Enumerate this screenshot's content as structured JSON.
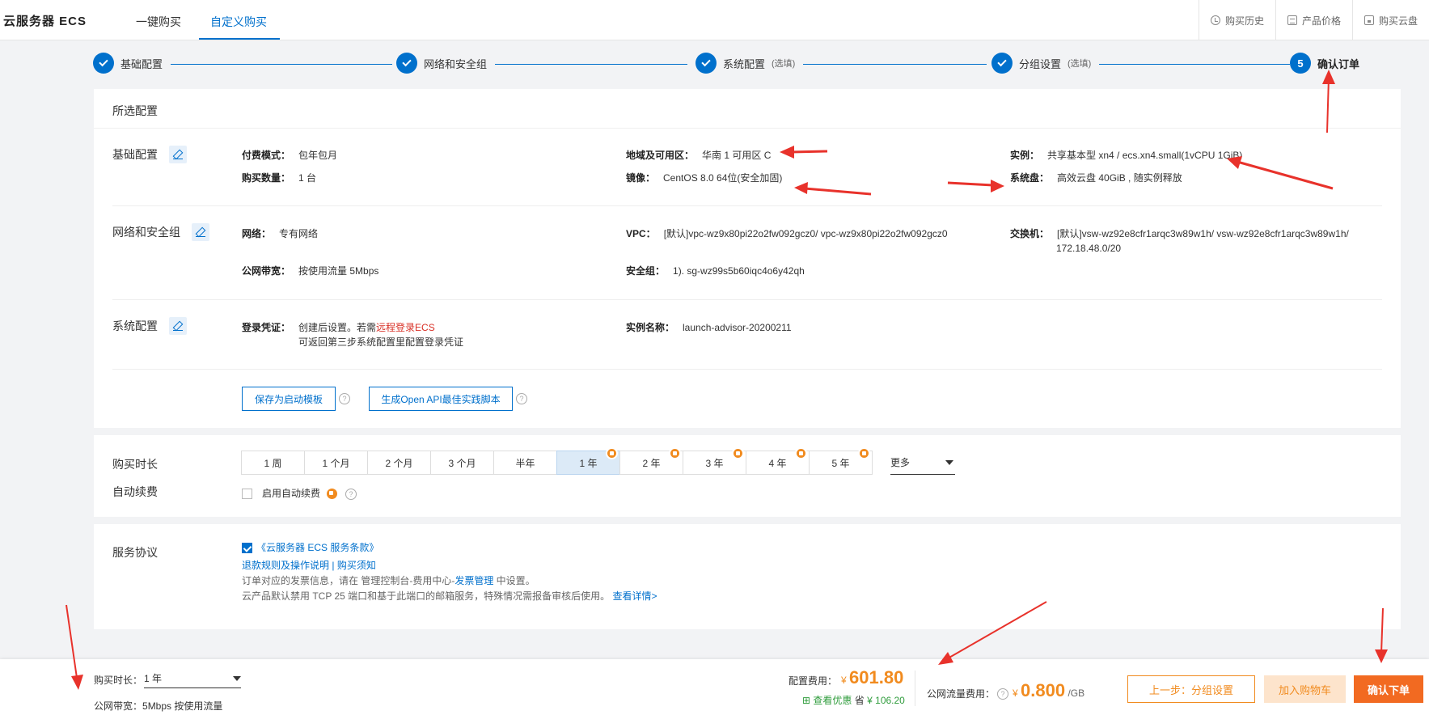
{
  "header": {
    "brand": "云服务器 ECS",
    "tabs": [
      "一键购买",
      "自定义购买"
    ],
    "links": [
      "购买历史",
      "产品价格",
      "购买云盘"
    ]
  },
  "steps": [
    {
      "label": "基础配置",
      "optional": ""
    },
    {
      "label": "网络和安全组",
      "optional": ""
    },
    {
      "label": "系统配置",
      "optional": "(选填)"
    },
    {
      "label": "分组设置",
      "optional": "(选填)"
    },
    {
      "num": "5",
      "label": "确认订单"
    }
  ],
  "summary": {
    "title": "所选配置",
    "basic": {
      "label": "基础配置",
      "pay_mode_k": "付费模式：",
      "pay_mode_v": "包年包月",
      "qty_k": "购买数量：",
      "qty_v": "1 台",
      "region_k": "地域及可用区：",
      "region_v": "华南 1 可用区 C",
      "image_k": "镜像：",
      "image_v": "CentOS 8.0 64位(安全加固)",
      "instance_k": "实例：",
      "instance_v": "共享基本型 xn4 / ecs.xn4.small(1vCPU 1GiB)",
      "disk_k": "系统盘：",
      "disk_v": "高效云盘 40GiB , 随实例释放"
    },
    "network": {
      "label": "网络和安全组",
      "net_k": "网络：",
      "net_v": "专有网络",
      "vpc_k": "VPC：",
      "vpc_v": "[默认]vpc-wz9x80pi22o2fw092gcz0/ vpc-wz9x80pi22o2fw092gcz0",
      "switch_k": "交换机：",
      "switch_v1": "[默认]vsw-wz92e8cfr1arqc3w89w1h/ vsw-wz92e8cfr1arqc3w89w1h/",
      "switch_v2": "172.18.48.0/20",
      "bw_k": "公网带宽：",
      "bw_v": "按使用流量 5Mbps",
      "sg_k": "安全组：",
      "sg_v": "1). sg-wz99s5b60iqc4o6y42qh"
    },
    "system": {
      "label": "系统配置",
      "login_k": "登录凭证：",
      "login_v1": "创建后设置。若需",
      "login_link": "远程登录ECS",
      "login_v2": "可返回第三步系统配置里配置登录凭证",
      "name_k": "实例名称：",
      "name_v": "launch-advisor-20200211"
    },
    "btn_template": "保存为启动模板",
    "btn_api": "生成Open API最佳实践脚本"
  },
  "duration": {
    "label": "购买时长",
    "options": [
      "1 周",
      "1 个月",
      "2 个月",
      "3 个月",
      "半年",
      "1 年",
      "2 年",
      "3 年",
      "4 年",
      "5 年"
    ],
    "selected": "1 年",
    "more": "更多",
    "renew_label": "自动续费",
    "renew_check": "启用自动续费"
  },
  "agreement": {
    "label": "服务协议",
    "terms": "《云服务器 ECS 服务条款》",
    "refund": "退款规则及操作说明",
    "sep": " | ",
    "notice": "购买须知",
    "invoice_1": "订单对应的发票信息，请在 管理控制台-费用中心-",
    "invoice_link": "发票管理",
    "invoice_2": " 中设置。",
    "tcp": "云产品默认禁用 TCP 25 端口和基于此端口的邮箱服务，特殊情况需报备审核后使用。",
    "detail": "查看详情>"
  },
  "footer": {
    "dur_label": "购买时长：",
    "dur_value": "1 年",
    "bw_label": "公网带宽：",
    "bw_value": "5Mbps 按使用流量",
    "cfg_label": "配置费用：",
    "currency": "¥",
    "cfg_price": "601.80",
    "discount_link": "查看优惠",
    "save_label": "省",
    "save_amount": "106.20",
    "traffic_label": "公网流量费用：",
    "traffic_price": "0.800",
    "traffic_unit": "/GB",
    "btn_prev": "上一步：分组设置",
    "btn_cart": "加入购物车",
    "btn_confirm": "确认下单"
  },
  "colors": {
    "accent": "#0070cc",
    "orange": "#f18b1f",
    "annotation": "#e8322b"
  }
}
